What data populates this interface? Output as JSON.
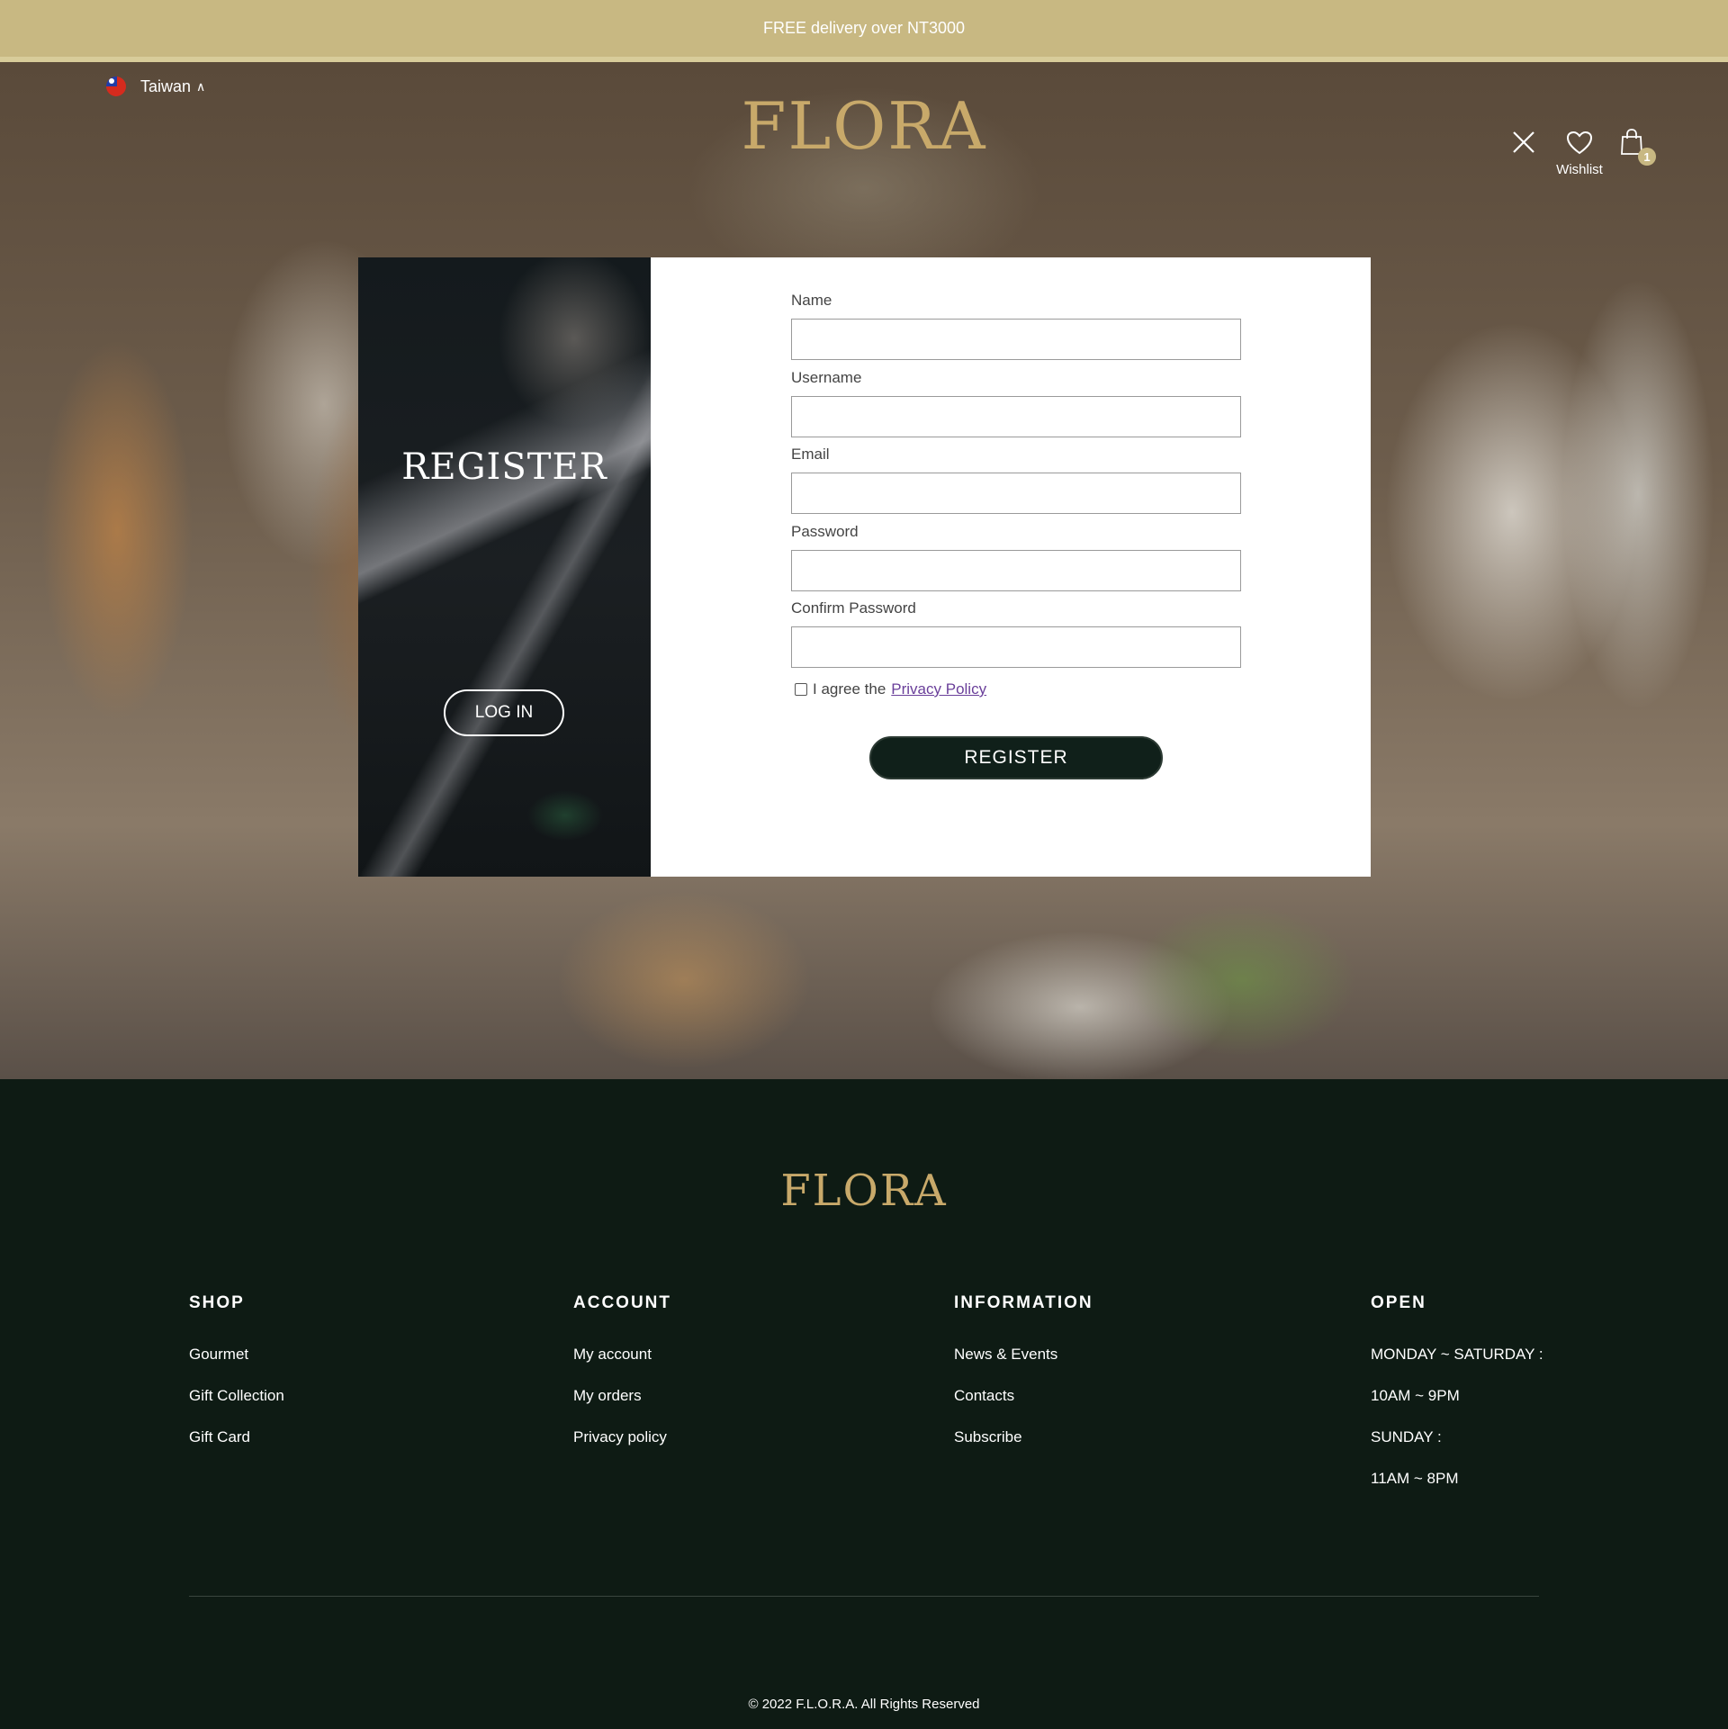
{
  "banner": {
    "text": "FREE delivery over NT3000"
  },
  "header": {
    "country": "Taiwan",
    "logo": "FLORA",
    "wishlist_label": "Wishlist",
    "cart_count": "1",
    "icons": [
      "close-icon",
      "heart-icon",
      "shopping-bag-icon",
      "chevron-up-icon",
      "taiwan-flag-icon"
    ]
  },
  "register_panel": {
    "title": "REGISTER",
    "login_button": "LOG IN"
  },
  "form": {
    "fields": [
      {
        "label": "Name",
        "value": ""
      },
      {
        "label": "Username",
        "value": ""
      },
      {
        "label": "Email",
        "value": ""
      },
      {
        "label": "Password",
        "value": ""
      },
      {
        "label": "Confirm Password",
        "value": ""
      }
    ],
    "agree_text": "I agree the",
    "agree_link": "Privacy Policy",
    "agree_checked": false,
    "submit_label": "REGISTER"
  },
  "footer": {
    "logo": "FLORA",
    "columns": [
      {
        "heading": "SHOP",
        "items": [
          "Gourmet",
          "Gift Collection",
          "Gift Card"
        ]
      },
      {
        "heading": "ACCOUNT",
        "items": [
          "My account",
          "My orders",
          "Privacy policy"
        ]
      },
      {
        "heading": "INFORMATION",
        "items": [
          "News & Events",
          "Contacts",
          "Subscribe"
        ]
      },
      {
        "heading": "OPEN",
        "items": [
          "MONDAY ~ SATURDAY :",
          "10AM ~ 9PM",
          "SUNDAY :",
          "11AM ~ 8PM"
        ]
      }
    ],
    "copyright": "© 2022 F.L.O.R.A. All Rights Reserved"
  },
  "colors": {
    "banner": "#c8b882",
    "gold_logo": "#c8a96a",
    "footer_bg": "#0e1b14",
    "button_dark": "#10201a",
    "link": "#6a3f9a"
  }
}
